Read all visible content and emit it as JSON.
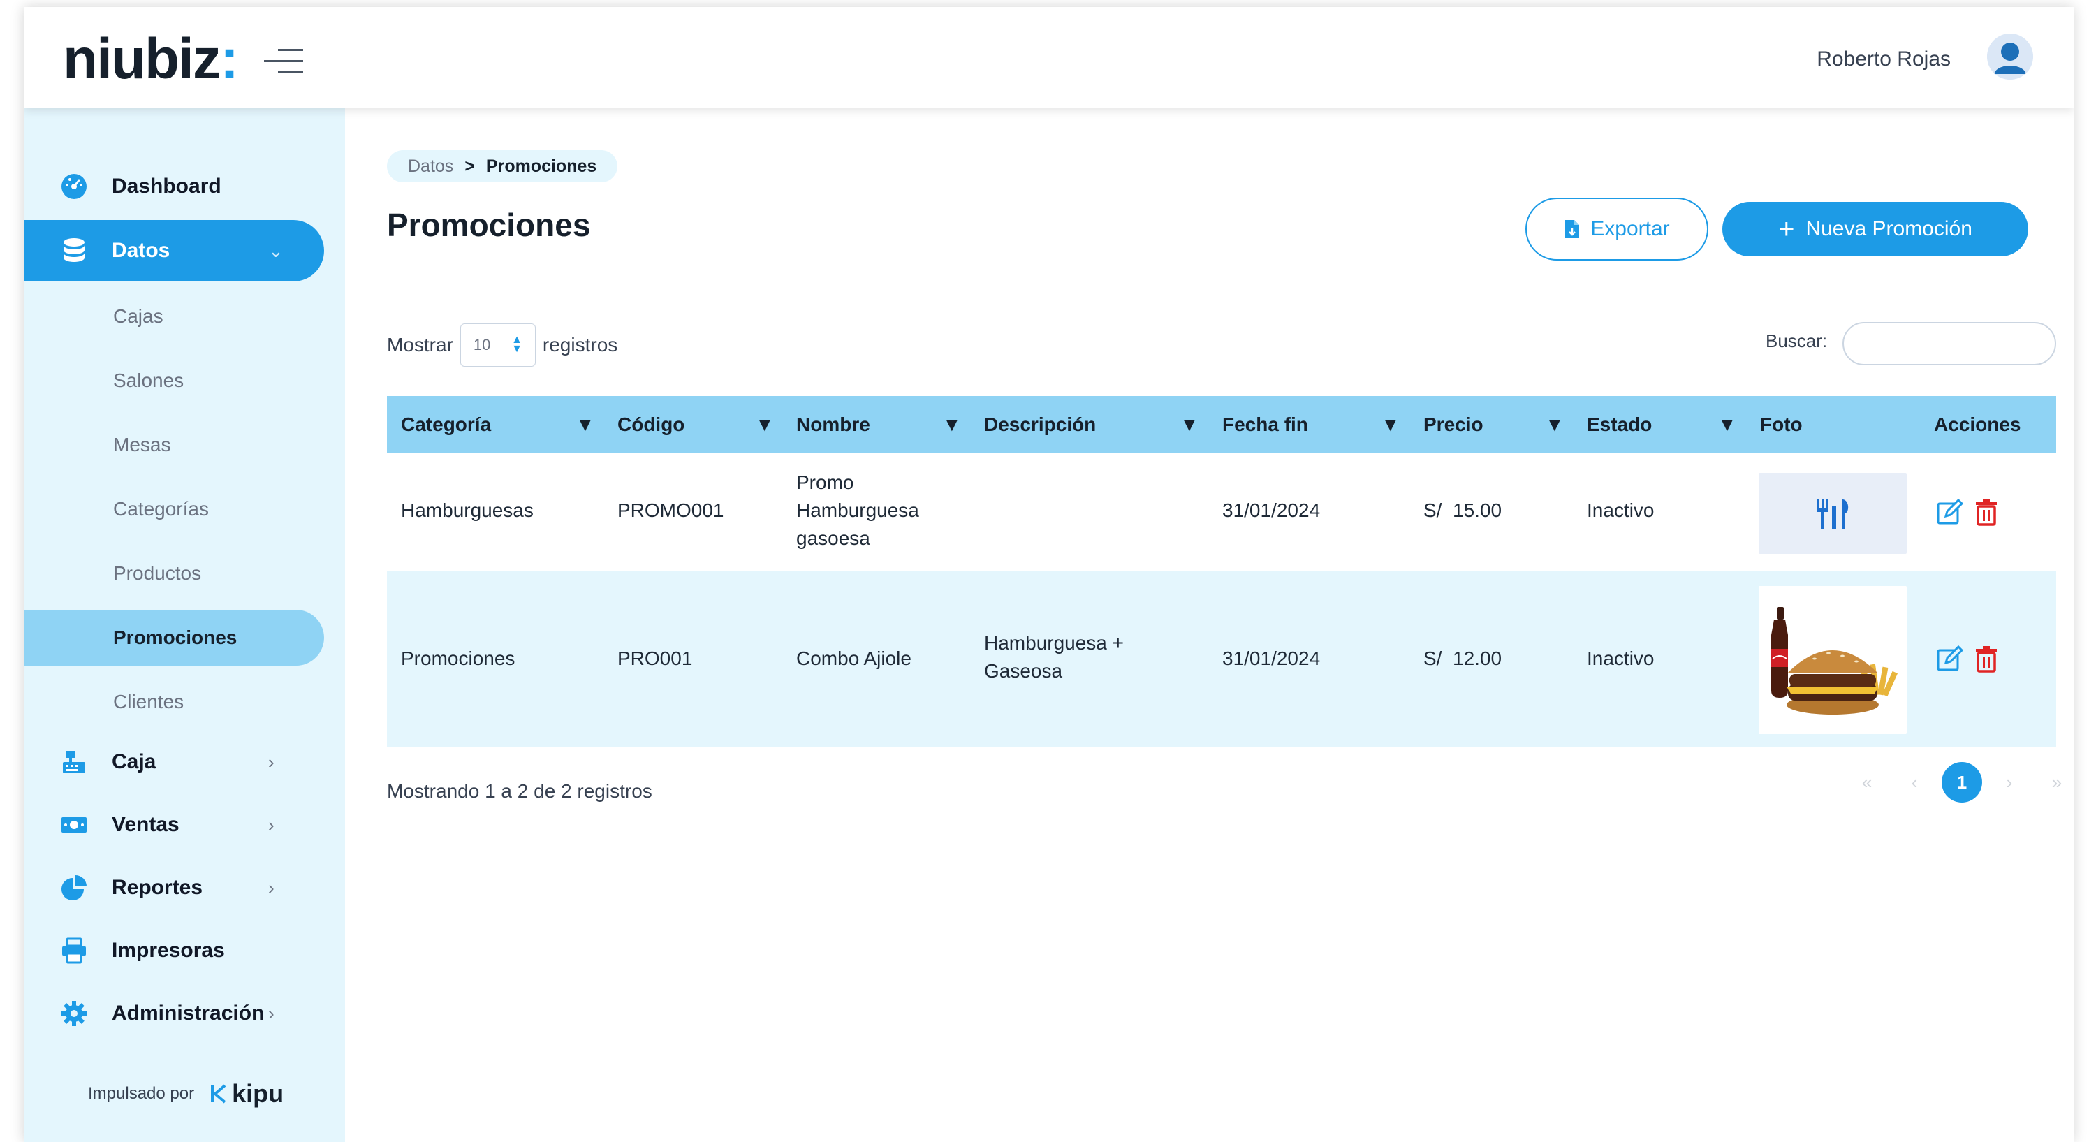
{
  "header": {
    "logo_text": "niubiz",
    "logo_colon": ":",
    "user_name": "Roberto Rojas"
  },
  "sidebar": {
    "items": [
      {
        "label": "Dashboard",
        "icon": "dashboard-gauge-icon"
      },
      {
        "label": "Datos",
        "icon": "database-icon",
        "chevron": "⌄",
        "active": true
      },
      {
        "label": "Caja",
        "icon": "cash-register-icon",
        "chevron": "›"
      },
      {
        "label": "Ventas",
        "icon": "money-bill-icon",
        "chevron": "›"
      },
      {
        "label": "Reportes",
        "icon": "pie-chart-icon",
        "chevron": "›"
      },
      {
        "label": "Impresoras",
        "icon": "printer-icon"
      },
      {
        "label": "Administración",
        "icon": "gear-icon",
        "chevron": "›"
      }
    ],
    "subitems": [
      {
        "label": "Cajas"
      },
      {
        "label": "Salones"
      },
      {
        "label": "Mesas"
      },
      {
        "label": "Categorías"
      },
      {
        "label": "Productos"
      },
      {
        "label": "Promociones",
        "active": true
      },
      {
        "label": "Clientes"
      }
    ],
    "powered_by": "Impulsado por",
    "powered_brand": "kipu"
  },
  "main": {
    "breadcrumb": {
      "parent": "Datos",
      "separator": ">",
      "current": "Promociones"
    },
    "title": "Promociones",
    "export_label": "Exportar",
    "new_label": "Nueva Promoción",
    "new_plus": "+",
    "show_label": "Mostrar",
    "page_size": "10",
    "records_label": "registros",
    "search_label": "Buscar:",
    "search_value": "",
    "columns": [
      "Categoría",
      "Código",
      "Nombre",
      "Descripción",
      "Fecha fin",
      "Precio",
      "Estado",
      "Foto",
      "Acciones"
    ],
    "sort_glyph": "▼",
    "rows": [
      {
        "categoria": "Hamburguesas",
        "codigo": "PROMO001",
        "nombre": [
          "Promo",
          "Hamburguesa",
          "gasoesa"
        ],
        "descripcion": [],
        "fecha_fin": "31/01/2024",
        "precio": "S/  15.00",
        "estado": "Inactivo",
        "foto": "utensils-placeholder-icon"
      },
      {
        "categoria": "Promociones",
        "codigo": "PRO001",
        "nombre": [
          "Combo Ajiole"
        ],
        "descripcion": [
          "Hamburguesa +",
          "Gaseosa"
        ],
        "fecha_fin": "31/01/2024",
        "precio": "S/  12.00",
        "estado": "Inactivo",
        "foto": "burger-soda-fries-photo"
      }
    ],
    "info": "Mostrando 1 a 2 de 2 registros",
    "pagination": {
      "first": "«",
      "prev": "‹",
      "current": "1",
      "next": "›",
      "last": "»"
    }
  },
  "colors": {
    "accent": "#1d9be6",
    "header_row": "#8fd3f4",
    "sidebar_bg": "#e4f6fd",
    "delete": "#e02424"
  }
}
